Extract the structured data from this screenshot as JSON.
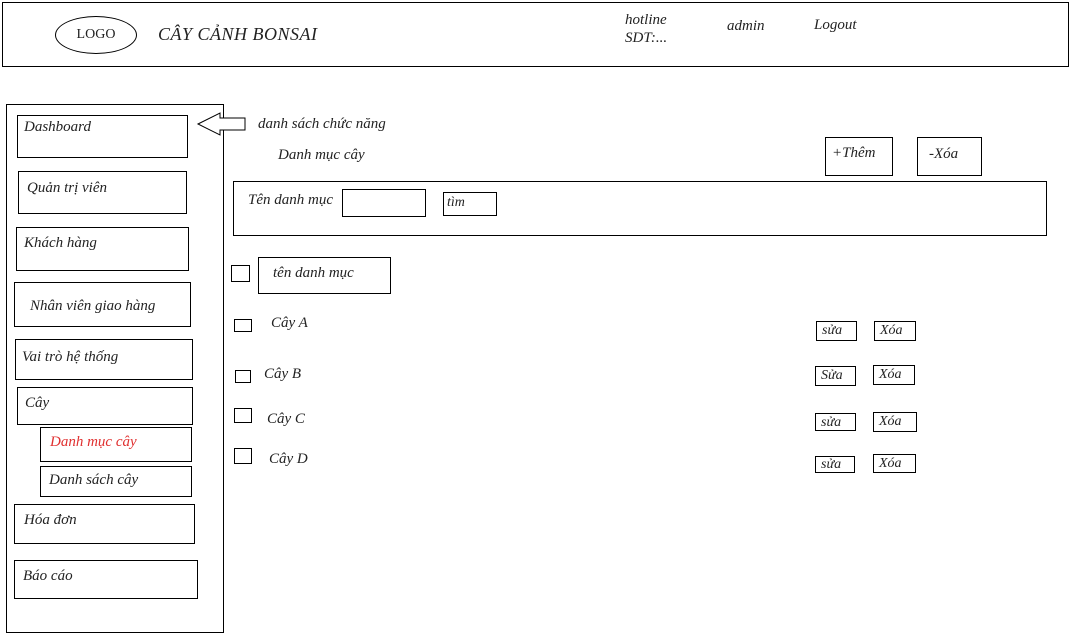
{
  "header": {
    "logo": "LOGO",
    "site_title": "CÂY CẢNH BONSAI",
    "hotline": "hotline",
    "sdt": "SDT:...",
    "admin": "admin",
    "logout": "Logout"
  },
  "sidebar": {
    "items": [
      {
        "label": "Dashboard"
      },
      {
        "label": "Quản trị viên"
      },
      {
        "label": "Khách hàng"
      },
      {
        "label": "Nhân viên giao hàng"
      },
      {
        "label": "Vai trò hệ thống"
      },
      {
        "label": "Cây"
      },
      {
        "label": "Danh mục cây"
      },
      {
        "label": "Danh sách cây"
      },
      {
        "label": "Hóa đơn"
      },
      {
        "label": "Báo cáo"
      }
    ],
    "active_color": "#e03030"
  },
  "annotation": "danh sách chức năng",
  "main": {
    "page_title": "Danh mục cây",
    "add_button": "+Thêm",
    "delete_button": "-Xóa",
    "search": {
      "label": "Tên danh mục",
      "input_value": "",
      "button": "tìm"
    },
    "list_header": "tên danh mục",
    "rows": [
      {
        "name": "Cây A",
        "edit": "sửa",
        "delete": "Xóa"
      },
      {
        "name": "Cây B",
        "edit": "Sửa",
        "delete": "Xóa"
      },
      {
        "name": "Cây C",
        "edit": "sửa",
        "delete": "Xóa"
      },
      {
        "name": "Cây D",
        "edit": "sửa",
        "delete": "Xóa"
      }
    ]
  }
}
